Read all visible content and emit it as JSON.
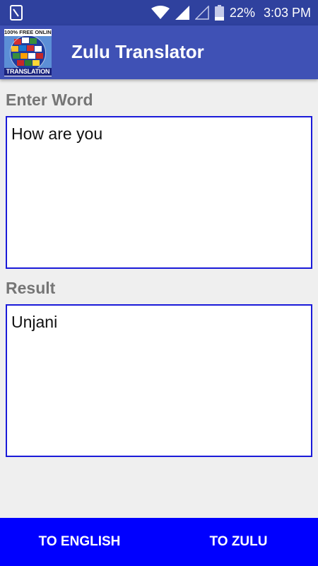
{
  "status_bar": {
    "battery_percent": "22%",
    "time": "3:03 PM",
    "icons": [
      "notification-icon",
      "wifi-icon",
      "signal-icon",
      "signal-empty-icon",
      "battery-icon"
    ]
  },
  "app_bar": {
    "title": "Zulu Translator",
    "logo_top_text": "100% FREE ONLINE",
    "logo_bottom_text": "TRANSLATION"
  },
  "input_section": {
    "label": "Enter Word",
    "value": "How are you"
  },
  "result_section": {
    "label": "Result",
    "value": "Unjani"
  },
  "bottom_bar": {
    "to_english_label": "TO ENGLISH",
    "to_zulu_label": "TO ZULU"
  },
  "colors": {
    "status_bar": "#2f419e",
    "app_bar": "#3f51b5",
    "background": "#efefef",
    "box_border": "#1a1ad9",
    "bottom_bar": "#0000ff",
    "label": "#757575"
  }
}
